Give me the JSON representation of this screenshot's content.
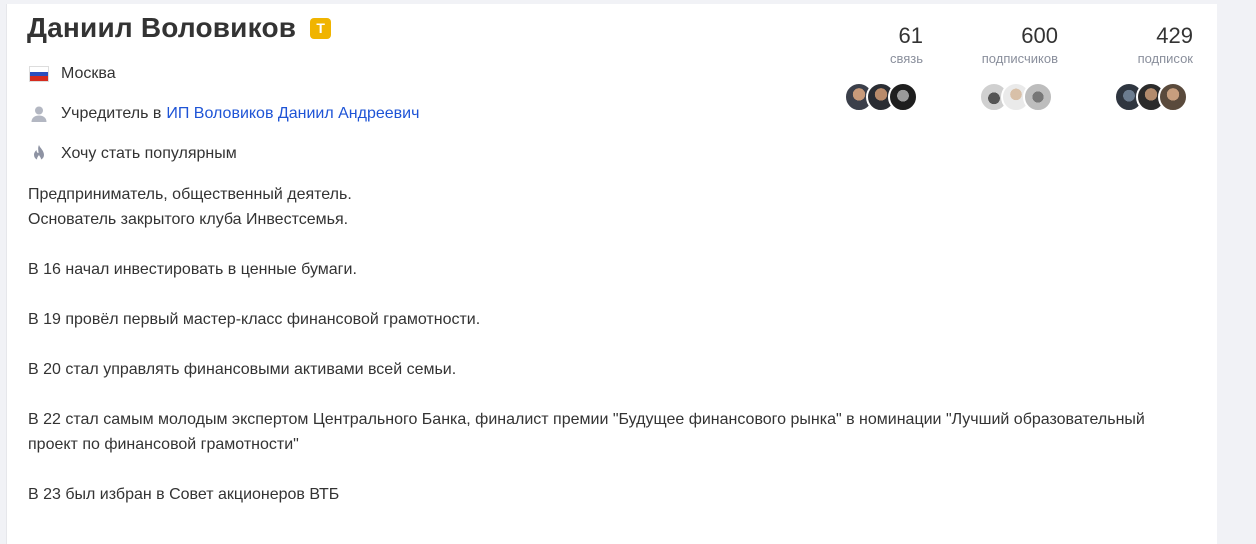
{
  "profile": {
    "name": "Даниил Воловиков",
    "badge_letter": "T",
    "city": "Москва",
    "role_prefix": "Учредитель в",
    "role_company": "ИП Воловиков Даниил Андреевич",
    "goal": "Хочу стать популярным"
  },
  "bio": {
    "l1": "Предприниматель, общественный деятель.",
    "l2": "Основатель закрытого клуба Инвестсемья.",
    "l3": "В 16 начал инвестировать в ценные бумаги.",
    "l4": "В 19 провёл первый мастер-класс финансовой грамотности.",
    "l5": "В 20 стал управлять финансовыми активами всей семьи.",
    "l6": "В 22 стал самым молодым экспертом Центрального Банка, финалист премии \"Будущее финансового рынка\" в номинации \"Лучший образовательный проект по финансовой грамотности\"",
    "l7": "В 23 был избран в Совет акционеров ВТБ"
  },
  "stats": {
    "connections": {
      "value": "61",
      "label": "связь"
    },
    "followers": {
      "value": "600",
      "label": "подписчиков"
    },
    "following": {
      "value": "429",
      "label": "подписок"
    }
  },
  "colors": {
    "accent": "#1e54d6",
    "badge": "#f0b400",
    "background": "#f1f2f6"
  }
}
